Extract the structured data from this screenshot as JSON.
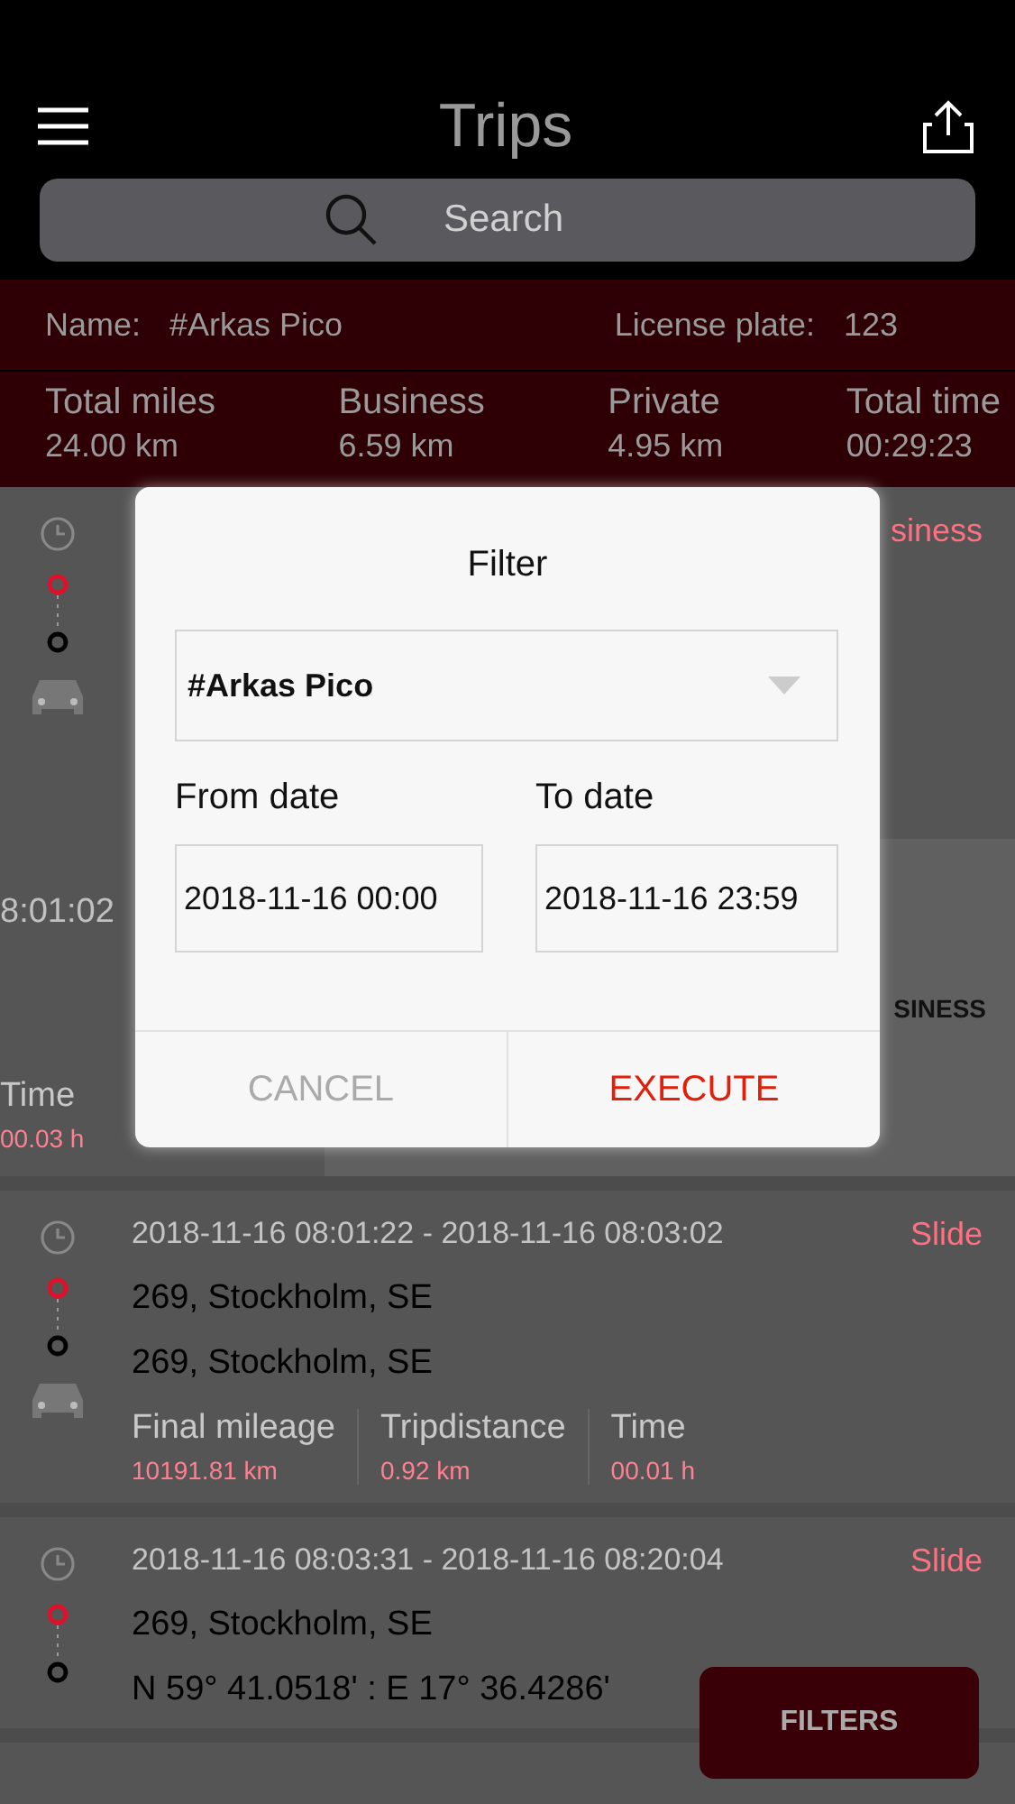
{
  "header": {
    "title": "Trips"
  },
  "search": {
    "placeholder": "Search"
  },
  "vehicle": {
    "name_label": "Name:",
    "name": "#Arkas Pico",
    "plate_label": "License plate:",
    "plate": "123"
  },
  "totals": [
    {
      "label": "Total miles",
      "value": "24.00 km"
    },
    {
      "label": "Business",
      "value": "6.59 km"
    },
    {
      "label": "Private",
      "value": "4.95 km"
    },
    {
      "label": "Total time",
      "value": "00:29:23"
    }
  ],
  "covered_trip": {
    "tag": "siness",
    "time_fragment": "8:01:02",
    "stat_label": "Time",
    "stat_value": "00.03 h",
    "action": "SINESS"
  },
  "trips": [
    {
      "date_range": "2018-11-16 08:01:22 - 2018-11-16 08:03:02",
      "tag": "Slide",
      "from": "269, Stockholm, SE",
      "to": "269, Stockholm, SE",
      "stats": [
        {
          "label": "Final mileage",
          "value": "10191.81 km"
        },
        {
          "label": "Tripdistance",
          "value": "0.92 km"
        },
        {
          "label": "Time",
          "value": "00.01 h"
        }
      ]
    },
    {
      "date_range": "2018-11-16 08:03:31 - 2018-11-16 08:20:04",
      "tag": "Slide",
      "from": "269, Stockholm, SE",
      "to": "N 59° 41.0518' : E 17° 36.4286'"
    }
  ],
  "filters_button": "FILTERS",
  "dialog": {
    "title": "Filter",
    "vehicle": "#Arkas Pico",
    "from_label": "From date",
    "from_value": "2018-11-16 00:00",
    "to_label": "To date",
    "to_value": "2018-11-16 23:59",
    "buttons": [
      {
        "label": "CANCEL",
        "kind": "cancel"
      },
      {
        "label": "EXECUTE",
        "kind": "primary"
      }
    ]
  }
}
